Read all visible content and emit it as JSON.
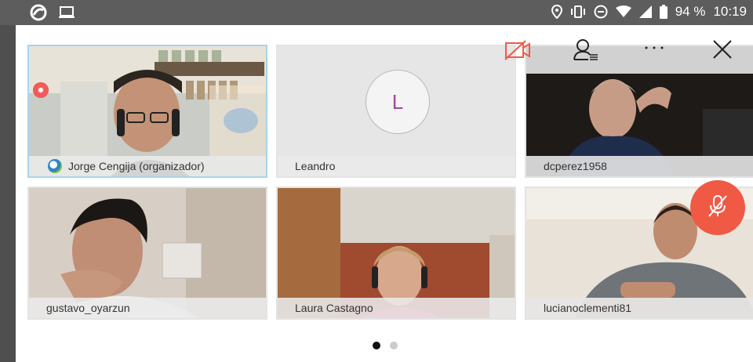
{
  "status_bar": {
    "battery_percent": "94 %",
    "time": "10:19",
    "icons": [
      "meeting-app-icon",
      "laptop-icon",
      "location-icon",
      "vibrate-icon",
      "do-not-disturb-icon",
      "wifi-icon",
      "cell-signal-icon",
      "battery-icon"
    ]
  },
  "controls": {
    "icons": [
      "video-off-icon",
      "participants-icon",
      "more-icon",
      "close-icon",
      "mic-off-icon"
    ],
    "accent_color": "#f05a45"
  },
  "participants": [
    {
      "name": "Jorge Cengija (organizador)",
      "video": true,
      "active_speaker": true,
      "recording": true
    },
    {
      "name": "Leandro",
      "video": false,
      "initial": "L"
    },
    {
      "name": "dcperez1958",
      "video": true
    },
    {
      "name": "gustavo_oyarzun",
      "video": true
    },
    {
      "name": "Laura Castagno",
      "video": true
    },
    {
      "name": "lucianoclementi81",
      "video": true
    }
  ],
  "pager": {
    "pages": 2,
    "current": 1
  }
}
